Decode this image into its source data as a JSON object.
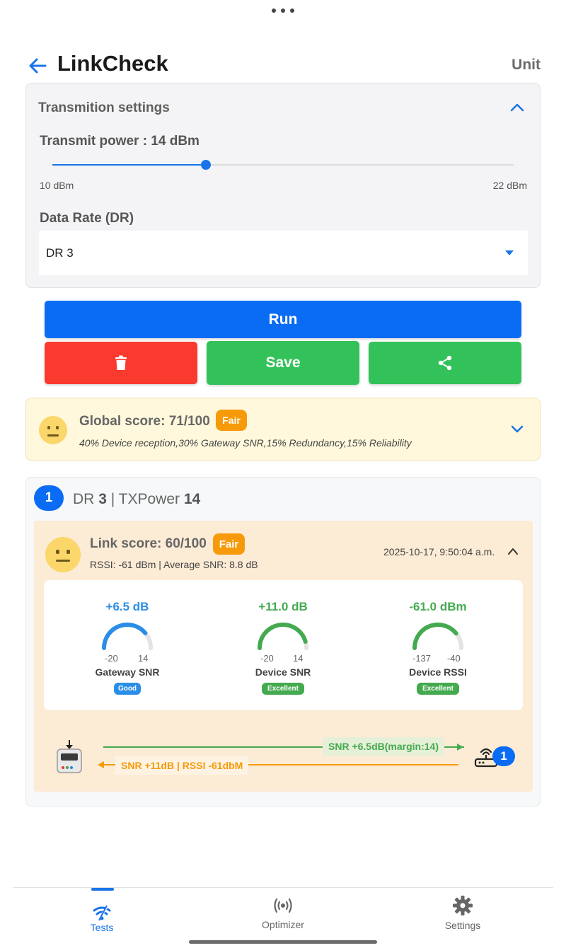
{
  "header": {
    "title": "LinkCheck",
    "unit_label": "Unit"
  },
  "settings": {
    "title": "Transmition settings",
    "power_label": "Transmit power : 14 dBm",
    "power_min_label": "10 dBm",
    "power_max_label": "22 dBm",
    "power_min": 10,
    "power_max": 22,
    "power_value": 14,
    "dr_label": "Data Rate (DR)",
    "dr_value": "DR 3"
  },
  "actions": {
    "run_label": "Run",
    "save_label": "Save",
    "delete_icon": "trash-icon",
    "share_icon": "share-icon"
  },
  "global_score": {
    "score_label": "Global score: 71/100",
    "badge": "Fair",
    "description": "40% Device reception,30% Gateway SNR,15% Redundancy,15% Reliability"
  },
  "test": {
    "number": "1",
    "dr_prefix": "DR",
    "dr_value": "3",
    "separator": "|",
    "tx_prefix": "TXPower",
    "tx_value": "14",
    "link_score_label": "Link score: 60/100",
    "link_badge": "Fair",
    "summary": "RSSI: -61 dBm | Average SNR: 8.8 dB",
    "timestamp": "2025-10-17, 9:50:04 a.m.",
    "gauges": [
      {
        "value_text": "+6.5 dB",
        "value": 6.5,
        "min": -20,
        "max": 14,
        "min_label": "-20",
        "max_label": "14",
        "label": "Gateway SNR",
        "badge": "Good",
        "color": "#2b8ee6"
      },
      {
        "value_text": "+11.0 dB",
        "value": 11.0,
        "min": -20,
        "max": 14,
        "min_label": "-20",
        "max_label": "14",
        "label": "Device SNR",
        "badge": "Excellent",
        "color": "#44aa4f"
      },
      {
        "value_text": "-61.0 dBm",
        "value": -61.0,
        "min": -137,
        "max": -40,
        "min_label": "-137",
        "max_label": "-40",
        "label": "Device RSSI",
        "badge": "Excellent",
        "color": "#44aa4f"
      }
    ],
    "uplink_label": "SNR +6.5dB(margin:14)",
    "downlink_label": "SNR +11dB | RSSI -61dbM",
    "gateway_count": "1"
  },
  "nav": {
    "items": [
      {
        "label": "Tests",
        "icon": "wifi-signal-icon",
        "active": true
      },
      {
        "label": "Optimizer",
        "icon": "broadcast-icon",
        "active": false
      },
      {
        "label": "Settings",
        "icon": "gear-icon",
        "active": false
      }
    ]
  },
  "colors": {
    "primary": "#0a6cf5",
    "danger": "#fa3a2e",
    "success": "#33c25a",
    "warning": "#f79a0a"
  }
}
